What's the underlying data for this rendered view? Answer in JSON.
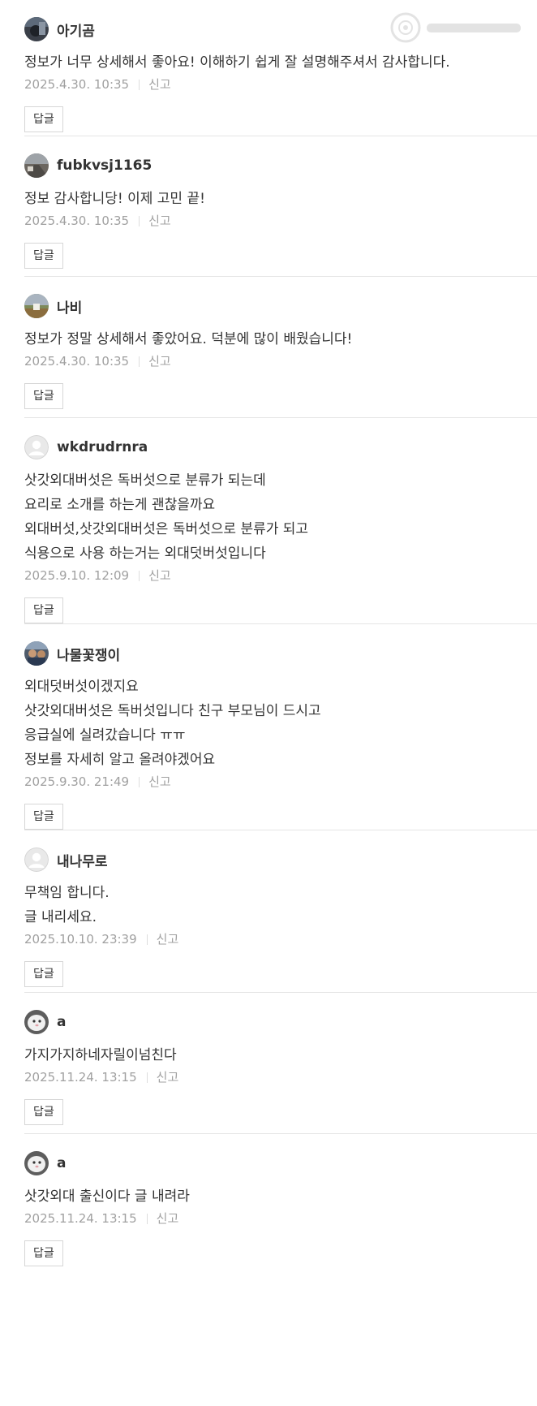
{
  "reply_label": "답글",
  "report_label": "신고",
  "comments": [
    {
      "author": "아기곰",
      "avatar": "photo-avatar-dark",
      "lines": [
        "정보가 너무 상세해서 좋아요! 이해하기 쉽게 잘 설명해주셔서 감사합니다."
      ],
      "date": "2025.4.30. 10:35"
    },
    {
      "author": "fubkvsj1165",
      "avatar": "photo-avatar-road",
      "lines": [
        "정보 감사합니당! 이제 고민 끝!"
      ],
      "date": "2025.4.30. 10:35"
    },
    {
      "author": "나비",
      "avatar": "photo-avatar-landscape",
      "lines": [
        "정보가 정말 상세해서 좋았어요. 덕분에 많이 배웠습니다!"
      ],
      "date": "2025.4.30. 10:35"
    },
    {
      "author": "wkdrudrnra",
      "avatar": "default-user-icon",
      "lines": [
        "삿갓외대버섯은 독버섯으로 분류가 되는데",
        "요리로 소개를 하는게 괜찮을까요",
        "외대버섯,삿갓외대버섯은 독버섯으로 분류가 되고",
        "식용으로 사용 하는거는 외대덧버섯입니다"
      ],
      "date": "2025.9.10. 12:09"
    },
    {
      "author": "나물꽃쟁이",
      "avatar": "photo-avatar-people",
      "lines": [
        "외대덧버섯이겠지요",
        "삿갓외대버섯은 독버섯입니다 친구 부모님이 드시고",
        "응급실에 실려갔습니다 ㅠㅠ",
        "정보를 자세히 알고 올려야겠어요"
      ],
      "date": "2025.9.30. 21:49"
    },
    {
      "author": "내나무로",
      "avatar": "default-user-icon",
      "lines": [
        "무책임 합니다.",
        "글 내리세요."
      ],
      "date": "2025.10.10. 23:39"
    },
    {
      "author": "a",
      "avatar": "photo-avatar-white-animal",
      "lines": [
        "가지가지하네자릴이넘친다"
      ],
      "date": "2025.11.24. 13:15"
    },
    {
      "author": "a",
      "avatar": "photo-avatar-white-animal",
      "lines": [
        "삿갓외대 출신이다 글 내려라"
      ],
      "date": "2025.11.24. 13:15"
    }
  ]
}
